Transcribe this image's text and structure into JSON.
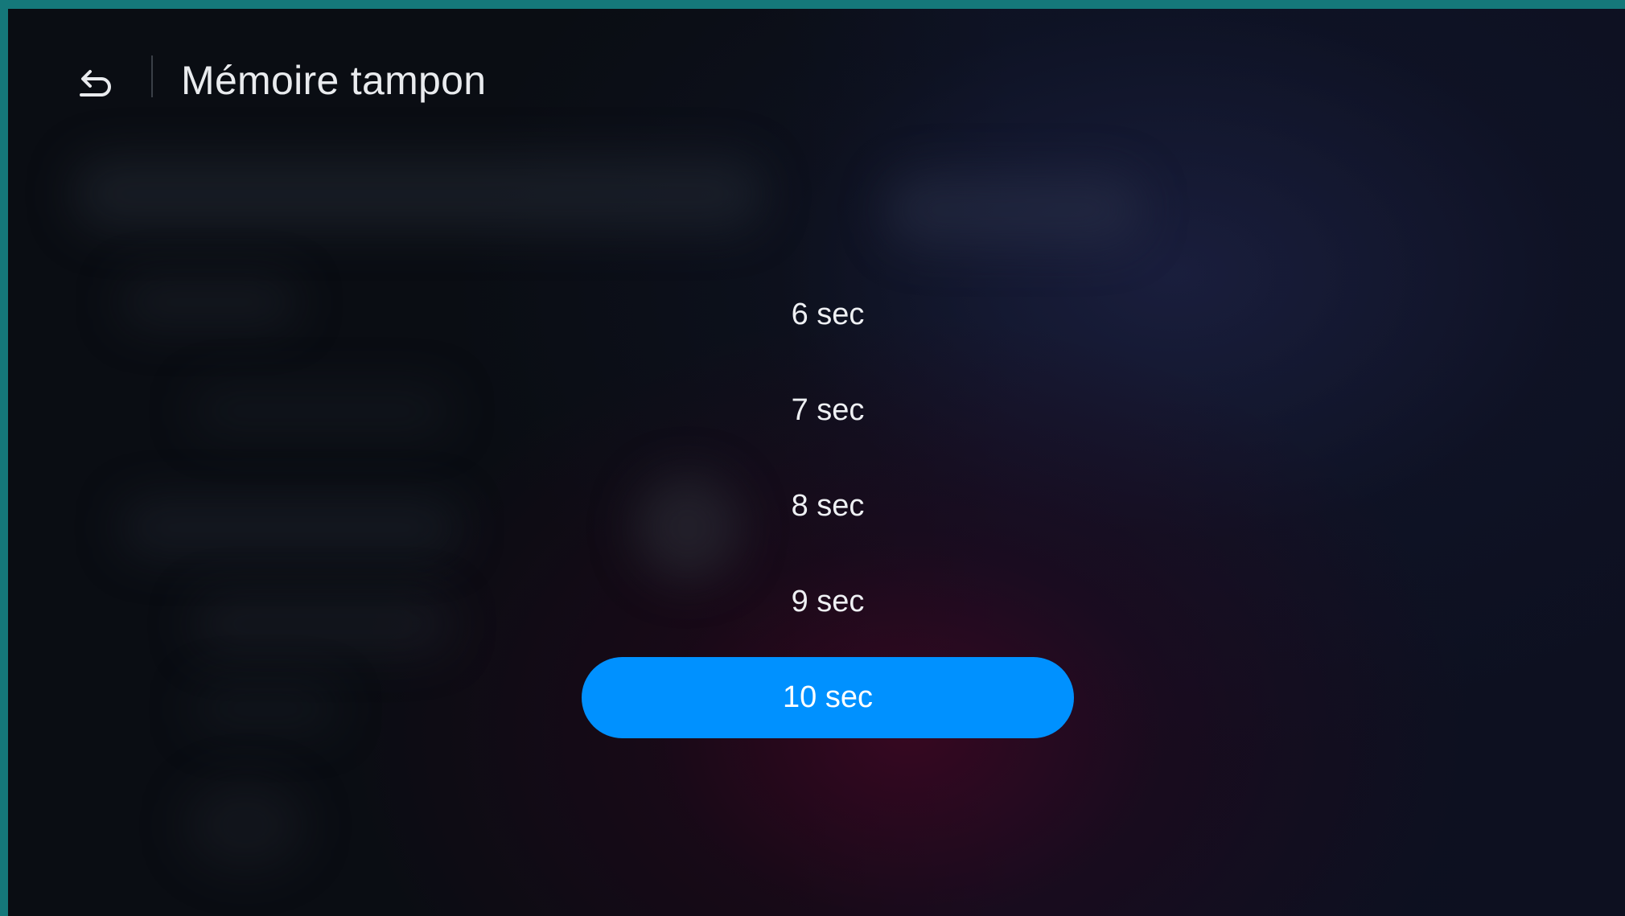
{
  "header": {
    "title": "Mémoire tampon",
    "back_icon": "back-arrow-icon"
  },
  "options": [
    {
      "label": "6 sec",
      "selected": false
    },
    {
      "label": "7 sec",
      "selected": false
    },
    {
      "label": "8 sec",
      "selected": false
    },
    {
      "label": "9 sec",
      "selected": false
    },
    {
      "label": "10 sec",
      "selected": true
    }
  ],
  "colors": {
    "accent": "#0091ff",
    "background": "#0a0d13",
    "border": "#15787a",
    "text": "#eef0f3"
  }
}
